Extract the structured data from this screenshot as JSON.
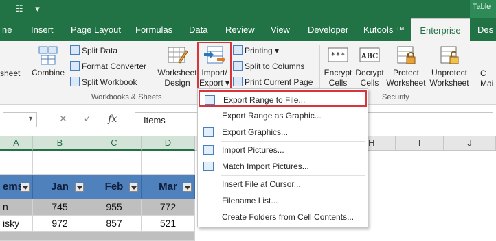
{
  "title_bar": {
    "context_tab": "Table"
  },
  "tabs": [
    {
      "label": "ne"
    },
    {
      "label": "Insert"
    },
    {
      "label": "Page Layout"
    },
    {
      "label": "Formulas"
    },
    {
      "label": "Data"
    },
    {
      "label": "Review"
    },
    {
      "label": "View"
    },
    {
      "label": "Developer"
    },
    {
      "label": "Kutools ™"
    },
    {
      "label": "Enterprise"
    },
    {
      "label": "Des"
    }
  ],
  "ribbon": {
    "sheet_partial": "sheet",
    "combine": "Combine",
    "split_data": "Split Data",
    "format_converter": "Format Converter",
    "split_workbook": "Split Workbook",
    "worksheet_design": [
      "Worksheet",
      "Design"
    ],
    "import_export": [
      "Import/",
      "Export ▾"
    ],
    "printing": "Printing ▾",
    "split_to_columns": "Split to Columns",
    "print_current_page": "Print Current Page",
    "encrypt_cells": [
      "Encrypt",
      "Cells"
    ],
    "decrypt_cells": [
      "Decrypt",
      "Cells"
    ],
    "protect_worksheet": [
      "Protect",
      "Worksheet"
    ],
    "unprotect_worksheet": [
      "Unprotect",
      "Worksheet"
    ],
    "partial_right": [
      "C",
      "Mai"
    ],
    "group_workbooks": "Workbooks & Sheets",
    "group_security": "Security"
  },
  "formula_bar": {
    "name_box": "",
    "content": "Items"
  },
  "grid": {
    "columns": [
      "A",
      "B",
      "C",
      "D",
      "H",
      "I",
      "J"
    ],
    "table_header": [
      "ems",
      "Jan",
      "Feb",
      "Mar"
    ],
    "rows": [
      [
        "n",
        "745",
        "955",
        "772"
      ],
      [
        "isky",
        "972",
        "857",
        "521"
      ]
    ]
  },
  "menu": {
    "items": [
      {
        "label": "Export Range to File...",
        "icon": "export-file-icon"
      },
      {
        "label": "Export Range as Graphic...",
        "icon": "none"
      },
      {
        "label": "Export Graphics...",
        "icon": "export-graphics-icon"
      },
      {
        "label": "Import Pictures...",
        "icon": "import-pictures-icon"
      },
      {
        "label": "Match Import Pictures...",
        "icon": "match-import-icon"
      },
      {
        "label": "Insert File at Cursor...",
        "icon": "none"
      },
      {
        "label": "Filename List...",
        "icon": "none"
      },
      {
        "label": "Create Folders from Cell Contents...",
        "icon": "none"
      }
    ]
  },
  "colors": {
    "excel_green": "#217346",
    "table_header_blue": "#4f81bd",
    "highlight_red": "#d9353a"
  }
}
